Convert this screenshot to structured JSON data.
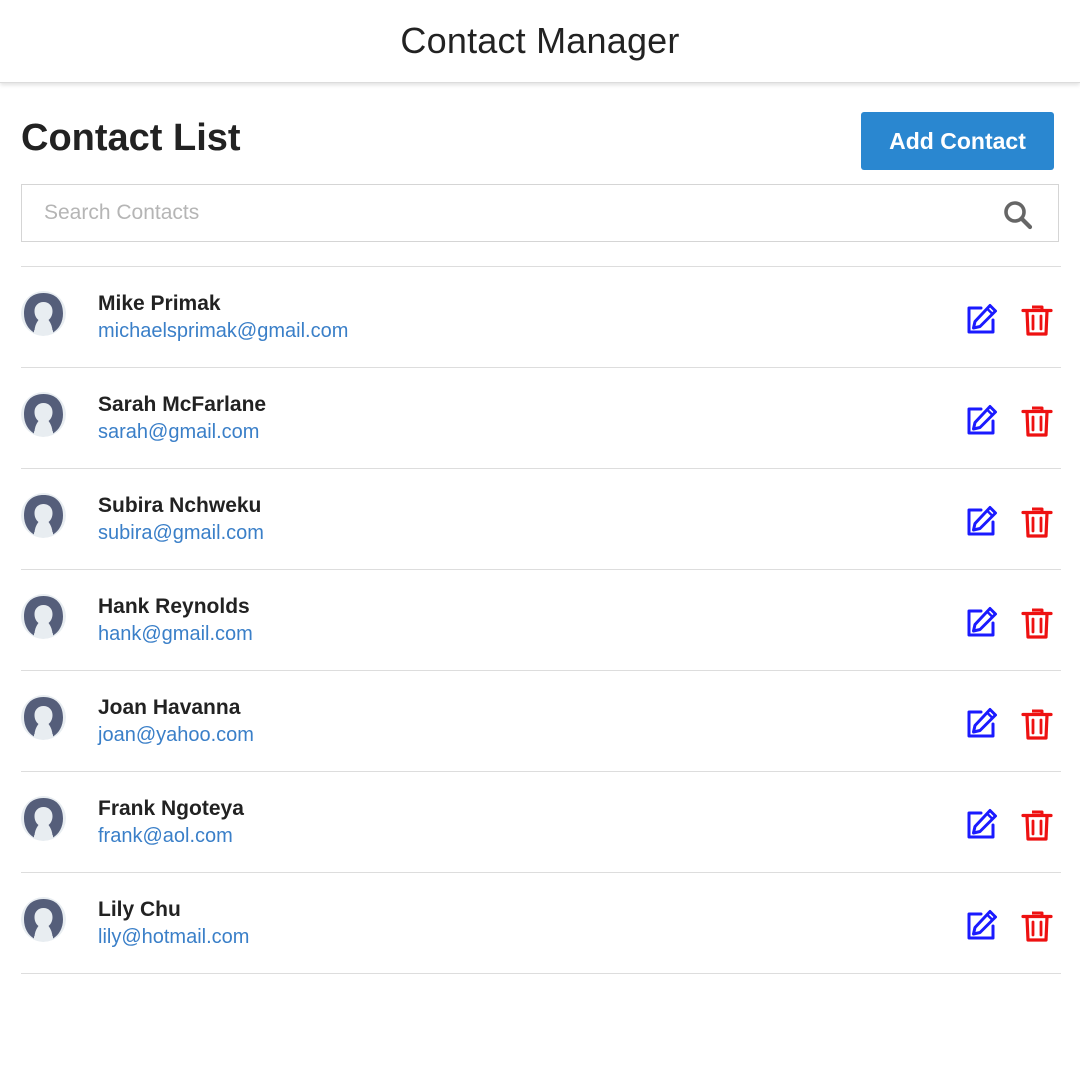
{
  "header": {
    "title": "Contact Manager"
  },
  "main": {
    "heading": "Contact List",
    "add_button_label": "Add Contact",
    "search": {
      "placeholder": "Search Contacts",
      "value": "",
      "icon": "search-icon"
    }
  },
  "contacts": [
    {
      "name": "Mike Primak",
      "email": "michaelsprimak@gmail.com"
    },
    {
      "name": "Sarah McFarlane",
      "email": "sarah@gmail.com"
    },
    {
      "name": "Subira Nchweku",
      "email": "subira@gmail.com"
    },
    {
      "name": "Hank Reynolds",
      "email": "hank@gmail.com"
    },
    {
      "name": "Joan Havanna",
      "email": "joan@yahoo.com"
    },
    {
      "name": "Frank Ngoteya",
      "email": "frank@aol.com"
    },
    {
      "name": "Lily Chu",
      "email": "lily@hotmail.com"
    }
  ],
  "icons": {
    "avatar": "user-avatar-icon",
    "edit": "edit-icon",
    "delete": "trash-icon"
  },
  "colors": {
    "accent": "#2a87d0",
    "email_link": "#3a7fc8",
    "edit_icon": "#1a1aff",
    "delete_icon": "#ee1111",
    "avatar_bg": "#e8edf1",
    "avatar_fg": "#555e7a"
  }
}
